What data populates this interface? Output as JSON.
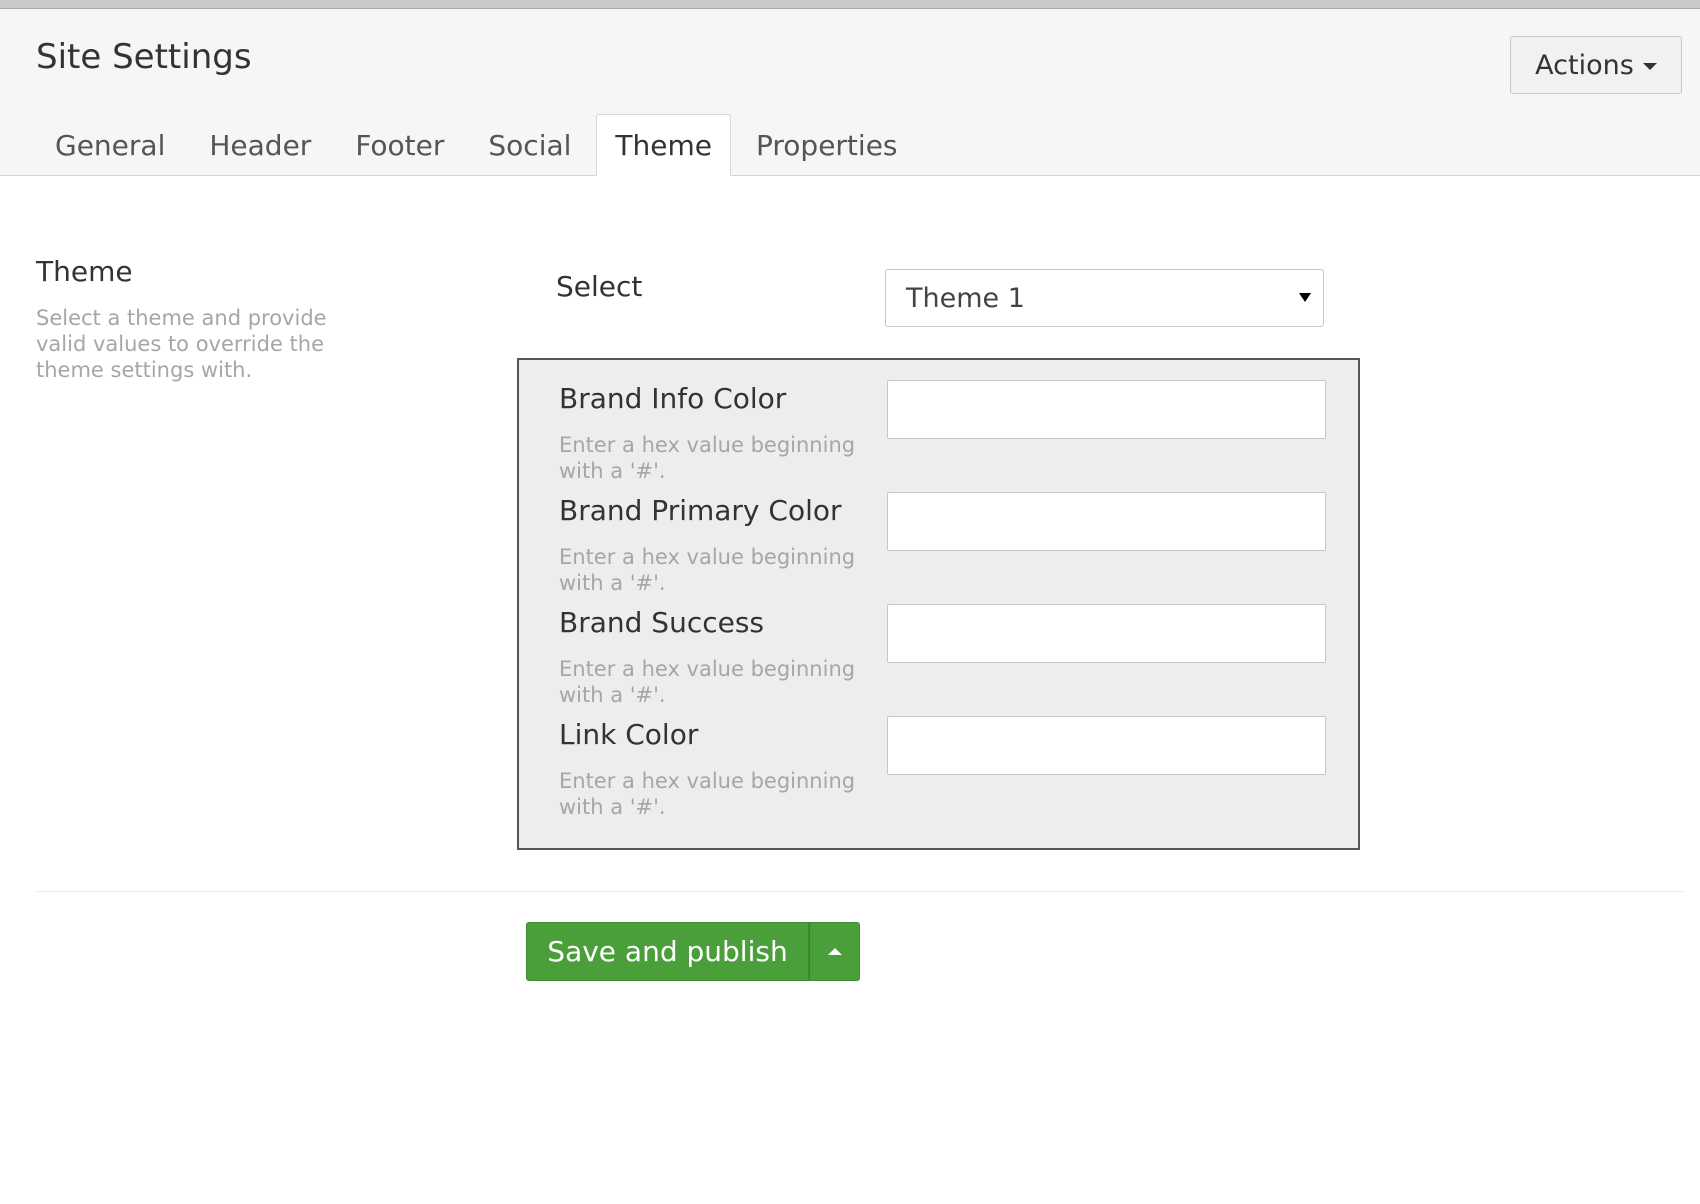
{
  "header": {
    "title": "Site Settings",
    "actions_label": "Actions"
  },
  "tabs": [
    {
      "label": "General",
      "active": false
    },
    {
      "label": "Header",
      "active": false
    },
    {
      "label": "Footer",
      "active": false
    },
    {
      "label": "Social",
      "active": false
    },
    {
      "label": "Theme",
      "active": true
    },
    {
      "label": "Properties",
      "active": false
    }
  ],
  "section": {
    "title": "Theme",
    "description": "Select a theme and provide valid values to override the theme settings with."
  },
  "theme_select": {
    "label": "Select",
    "value": "Theme 1"
  },
  "fields": [
    {
      "label": "Brand Info Color",
      "help": "Enter a hex value beginning with a '#'.",
      "value": ""
    },
    {
      "label": "Brand Primary Color",
      "help": "Enter a hex value beginning with a '#'.",
      "value": ""
    },
    {
      "label": "Brand Success",
      "help": "Enter a hex value beginning with a '#'.",
      "value": ""
    },
    {
      "label": "Link Color",
      "help": "Enter a hex value beginning with a '#'.",
      "value": ""
    }
  ],
  "footer": {
    "save_label": "Save and publish"
  },
  "colors": {
    "primary_button": "#4a9f3b",
    "panel_background": "#ededed",
    "header_background": "#f6f6f6",
    "help_text": "#a6a6a6"
  },
  "icons": {
    "actions_caret": "caret-down-icon",
    "select_caret": "caret-down-icon",
    "save_toggle": "caret-up-icon"
  }
}
